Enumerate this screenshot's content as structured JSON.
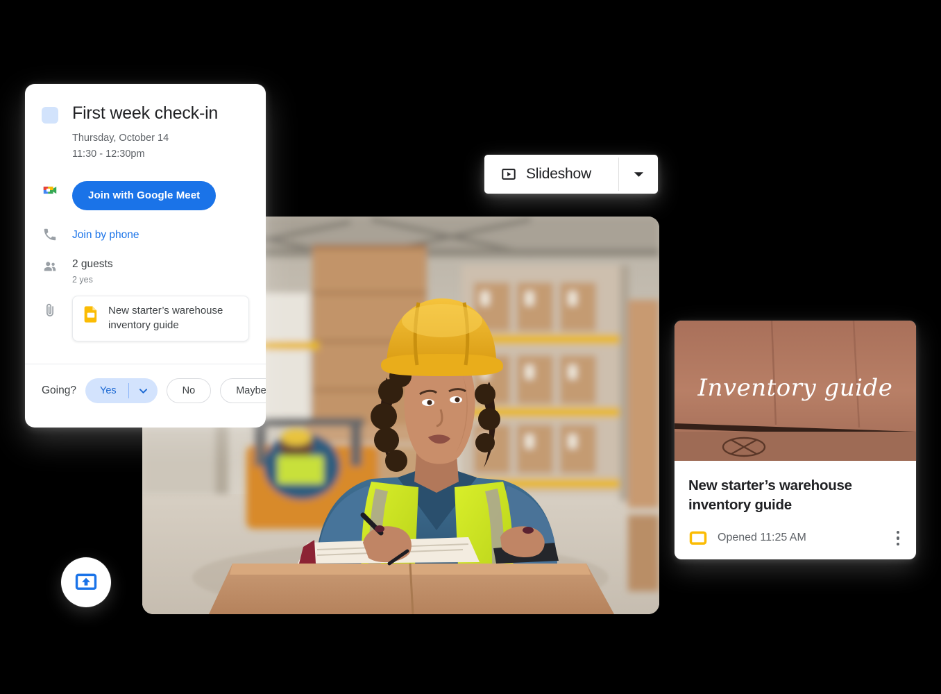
{
  "background_color": "#000000",
  "accent_colors": {
    "blue": "#1a73e8",
    "light_blue_pill": "#d3e3fd",
    "slides_yellow": "#fbbc04",
    "calendar_chip": "#d2e3fc",
    "text_primary": "#202124",
    "text_secondary": "#5f6368"
  },
  "calendar_event_card": {
    "color_chip_name": "calendar-color-chip",
    "title": "First week check-in",
    "date": "Thursday, October 14",
    "time": "11:30 - 12:30pm",
    "meet_icon_name": "google-meet-icon",
    "join_meet_label": "Join with Google Meet",
    "phone_icon_name": "phone-icon",
    "join_phone_label": "Join by phone",
    "guests_icon_name": "people-icon",
    "guests_count": "2 guests",
    "guests_rsvp": "2 yes",
    "attachment_icon_name": "paperclip-icon",
    "attachment": {
      "file_icon_name": "google-slides-icon",
      "name": "New starter’s warehouse inventory guide"
    },
    "rsvp": {
      "prompt": "Going?",
      "yes_label": "Yes",
      "yes_dropdown_icon_name": "chevron-down-icon",
      "no_label": "No",
      "maybe_label": "Maybe",
      "selected": "Yes"
    }
  },
  "slideshow_button": {
    "play_icon_name": "play-box-icon",
    "label": "Slideshow",
    "dropdown_icon_name": "chevron-down-icon"
  },
  "photo": {
    "alt_name": "warehouse-worker-photo",
    "description": "Woman wearing a yellow hard hat and hi-vis vest writing on a notepad atop a cardboard box in a warehouse"
  },
  "document_card": {
    "thumbnail": {
      "name": "inventory-guide-slide-thumbnail",
      "overlay_text": "Inventory guide"
    },
    "title": "New starter’s warehouse inventory guide",
    "app_icon_name": "google-slides-icon",
    "status": "Opened 11:25 AM",
    "more_icon_name": "more-vert-icon"
  },
  "present_button": {
    "icon_name": "present-to-screen-icon",
    "label": ""
  }
}
